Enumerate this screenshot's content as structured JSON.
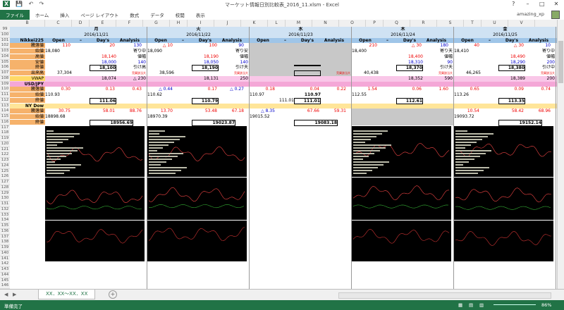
{
  "window": {
    "title": "マーケット情報日別比較表_2016_11.xlsm - Excel",
    "user": "amazing_xp",
    "qat": [
      "save-icon",
      "undo-icon",
      "redo-icon"
    ],
    "controls": [
      "?",
      "–",
      "□",
      "✕"
    ]
  },
  "ribbon": {
    "tabs": [
      "ファイル",
      "ホーム",
      "挿入",
      "ページ レイアウト",
      "数式",
      "データ",
      "校閲",
      "表示"
    ]
  },
  "columns": [
    "B",
    "C",
    "D",
    "E",
    "F",
    "G",
    "H",
    "I",
    "J",
    "K",
    "L",
    "M",
    "N",
    "O",
    "P",
    "Q",
    "R",
    "S",
    "T",
    "U",
    "V"
  ],
  "rows": [
    "99",
    "100",
    "101",
    "102",
    "103",
    "104",
    "105",
    "106",
    "107",
    "108",
    "109",
    "110",
    "111",
    "112",
    "113",
    "114",
    "115",
    "116",
    "117",
    "118",
    "119",
    "120",
    "121",
    "122",
    "123",
    "124",
    "125",
    "126",
    "127",
    "128",
    "129",
    "130",
    "131",
    "132",
    "133",
    "134",
    "135",
    "136",
    "137",
    "138",
    "139",
    "140",
    "141",
    "142",
    "143",
    "144",
    "145",
    "146"
  ],
  "row_labels": {
    "nikkei": "Nikkei225",
    "sub": [
      "騰落値",
      "始値",
      "高値",
      "安値",
      "終値",
      "出来高",
      "VWAP"
    ],
    "usdjpy": "USD/JPY",
    "fx_sub": [
      "騰落値",
      "始値",
      "終値"
    ],
    "nydow": "NY Dow",
    "dow_sub": [
      "騰落値",
      "始値",
      "終値"
    ]
  },
  "day_header_labels": [
    "Open",
    "–",
    "Day's",
    "Analysis"
  ],
  "days": [
    {
      "weekday": "月",
      "date": "2016/11/21",
      "n_change": [
        "110",
        "20",
        "130"
      ],
      "n_open": "18,080",
      "n_open_tag": "寄り中",
      "n_high": "18,140",
      "n_high_tag": "値幅",
      "n_low": "18,000",
      "n_low_tag": "140",
      "n_close": "18,100",
      "n_close_tag": "引け高",
      "n_vol": "37,304",
      "n_vol_note": "売買該当大",
      "n_vwap": "18,074",
      "n_vwap_tag": "△ 230",
      "fx_change": [
        "0.30",
        "0.13",
        "0.43"
      ],
      "fx_open": "110.93",
      "fx_close": "111.06",
      "dw_change": [
        "30.75",
        "58.01",
        "88.76"
      ],
      "dw_open": "18898.68",
      "dw_close": "18956.69"
    },
    {
      "weekday": "火",
      "date": "2016/11/22",
      "n_change": [
        "△ 10",
        "100",
        "90"
      ],
      "n_open": "18,090",
      "n_open_tag": "寄り安",
      "n_high": "18,190",
      "n_high_tag": "値幅",
      "n_low": "18,050",
      "n_low_tag": "140",
      "n_close": "18,190",
      "n_close_tag": "引け天",
      "n_vol": "38,596",
      "n_vol_note": "売買該当大",
      "n_vwap": "18,131",
      "n_vwap_tag": "250",
      "fx_change": [
        "△ 0.44",
        "0.17",
        "△ 0.27"
      ],
      "fx_open": "110.62",
      "fx_close": "110.79",
      "dw_change": [
        "13.70",
        "53.48",
        "67.18"
      ],
      "dw_open": "18970.39",
      "dw_close": "19023.87"
    },
    {
      "weekday": "水",
      "date": "2016/11/23",
      "n_change": [
        "",
        "",
        ""
      ],
      "n_open": "",
      "n_open_tag": "",
      "n_high": "",
      "n_high_tag": "",
      "n_low": "",
      "n_low_tag": "",
      "n_close": "",
      "n_close_tag": "",
      "n_vol": "",
      "n_vol_note": "売買該当大",
      "n_vwap": "",
      "n_vwap_tag": "",
      "fx_change": [
        "0.18",
        "0.04",
        "0.22"
      ],
      "fx_open": "110.97",
      "fx_close": "111.01",
      "fx_extra": "111.01",
      "fx_extra2": "110.97",
      "dw_change": [
        "△ 8.35",
        "67.66",
        "59.31"
      ],
      "dw_open": "19015.52",
      "dw_close": "19083.18"
    },
    {
      "weekday": "木",
      "date": "2016/11/24",
      "n_change": [
        "210",
        "△ 30",
        "180"
      ],
      "n_open": "18,400",
      "n_open_tag": "寄り天",
      "n_high": "18,400",
      "n_high_tag": "値幅",
      "n_low": "18,310",
      "n_low_tag": "90",
      "n_close": "18,370",
      "n_close_tag": "引け天",
      "n_vol": "40,438",
      "n_vol_note": "売買該当大",
      "n_vwap": "18,352",
      "n_vwap_tag": "590",
      "fx_change": [
        "1.54",
        "0.06",
        "1.60"
      ],
      "fx_open": "112.55",
      "fx_close": "112.61",
      "dw_change": [
        "",
        "",
        ""
      ],
      "dw_open": "",
      "dw_close": ""
    },
    {
      "weekday": "金",
      "date": "2016/11/25",
      "n_change": [
        "40",
        "△ 30",
        "10"
      ],
      "n_open": "18,410",
      "n_open_tag": "寄り中",
      "n_high": "18,490",
      "n_high_tag": "値幅",
      "n_low": "18,290",
      "n_low_tag": "200",
      "n_close": "18,380",
      "n_close_tag": "引け中",
      "n_vol": "46,265",
      "n_vol_note": "売買該当大",
      "n_vwap": "18,389",
      "n_vwap_tag": "200",
      "fx_change": [
        "0.65",
        "0.09",
        "0.74"
      ],
      "fx_open": "113.26",
      "fx_close": "113.35",
      "dw_change": [
        "10.54",
        "58.42",
        "68.96"
      ],
      "dw_open": "19093.72",
      "dw_close": "19152.14"
    }
  ],
  "sheet_tab": "XX．XX～XX．XX",
  "status": {
    "ready": "準備完了",
    "zoom": "86%"
  },
  "colors": {
    "excel_green": "#217346",
    "header_blue": "#cfe2f3",
    "nikkei_blue": "#9fc5e8",
    "fx_pink": "#f4a7d7",
    "dow_yellow": "#ffe599",
    "vwap_pink": "#f9c7e8"
  }
}
